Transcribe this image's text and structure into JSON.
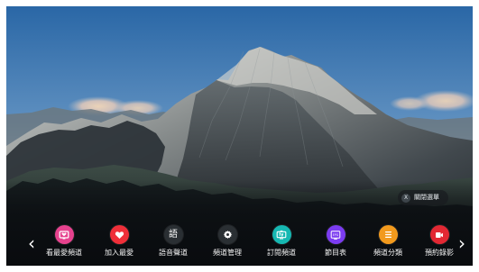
{
  "menu": {
    "close_label": "關閉選單",
    "close_badge": "X",
    "items": [
      {
        "label": "看最愛頻道",
        "icon": "favorite-channel-icon",
        "color": "#e6428e"
      },
      {
        "label": "加入最愛",
        "icon": "heart-icon",
        "color": "#ef2f39"
      },
      {
        "label": "語音聲道",
        "icon": "language-audio-icon",
        "color": "#2a2f33",
        "glyph": "語"
      },
      {
        "label": "頻道管理",
        "icon": "gear-icon",
        "color": "#2a2f33"
      },
      {
        "label": "訂閱頻道",
        "icon": "tv-subscribe-icon",
        "color": "#16b8b2"
      },
      {
        "label": "節目表",
        "icon": "epg-icon",
        "color": "#7b3cf0",
        "glyph": "EPG"
      },
      {
        "label": "頻道分類",
        "icon": "list-icon",
        "color": "#f29a1d"
      },
      {
        "label": "預約錄影",
        "icon": "record-icon",
        "color": "#e22833"
      }
    ]
  },
  "navigation": {
    "left_arrow": "‹",
    "right_arrow": "›"
  }
}
